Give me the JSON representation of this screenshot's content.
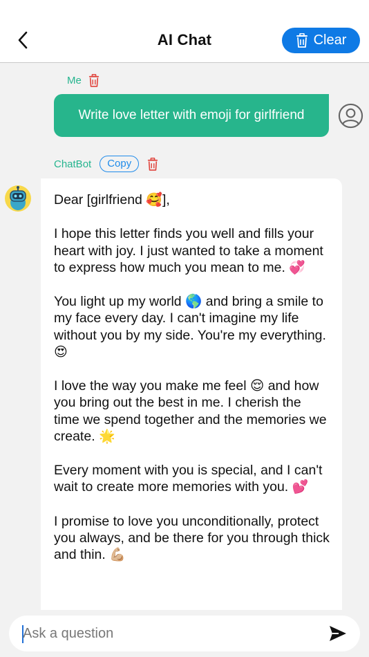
{
  "header": {
    "title": "AI Chat",
    "clear_label": "Clear",
    "back_icon": "chevron-left-icon",
    "clear_icon": "trash-icon"
  },
  "colors": {
    "accent_blue": "#0f7ae5",
    "user_bubble": "#27b58c",
    "delete_red": "#e0413a"
  },
  "user_message": {
    "sender": "Me",
    "text": "Write love letter with emoji for girlfriend"
  },
  "bot_message": {
    "sender": "ChatBot",
    "copy_label": "Copy",
    "paragraphs": [
      {
        "text": "Dear [girlfriend ",
        "emoji": "🥰",
        "after": "],"
      },
      {
        "text": "I hope this letter finds you well and fills your heart with joy. I just wanted to take a moment to express how much you mean to me. ",
        "emoji": "💞",
        "after": ""
      },
      {
        "text": "You light up my world 🌎 and bring a smile to my face every day. I can't imagine my life without you by my side. You're my everything. ",
        "emoji": "😍",
        "after": ""
      },
      {
        "text": "I love the way you make me feel 😌 and how you bring out the best in me. I cherish the time we spend together and the memories we create. ",
        "emoji": "🌟",
        "after": ""
      },
      {
        "text": "Every moment with you is special, and I can't wait to create more memories with you. ",
        "emoji": "💕",
        "after": ""
      },
      {
        "text": "I promise to love you unconditionally, protect you always, and be there for you through thick and thin. ",
        "emoji": "💪🏼",
        "after": ""
      }
    ]
  },
  "composer": {
    "placeholder": "Ask a question",
    "send_icon": "send-icon"
  }
}
